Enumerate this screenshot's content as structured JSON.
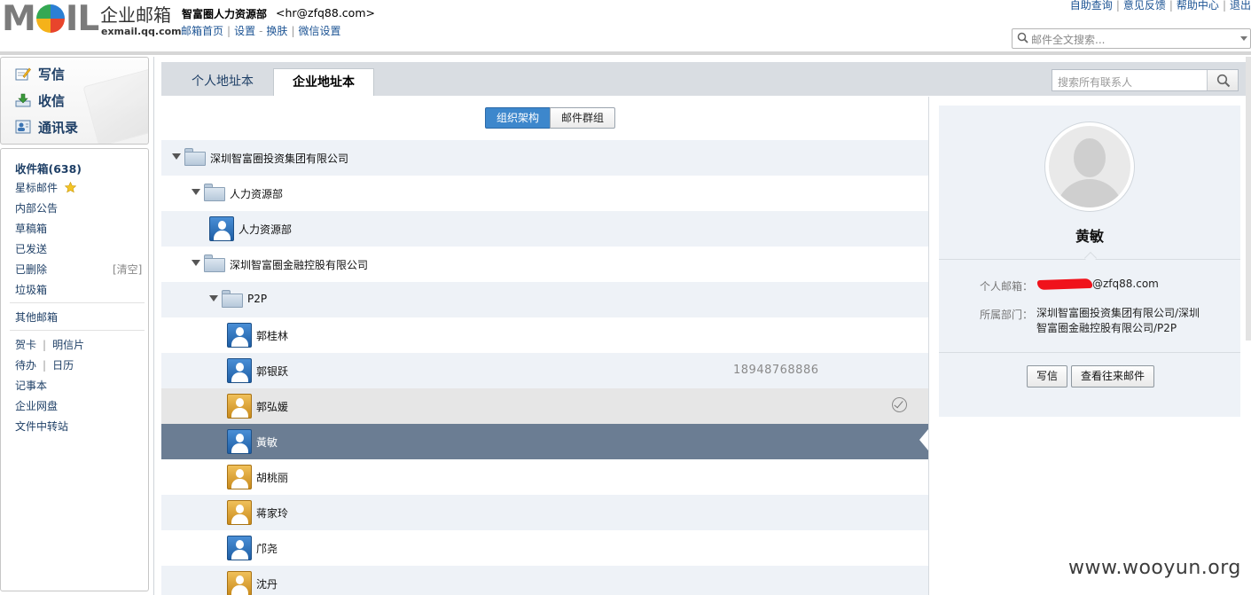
{
  "brand": {
    "logo_text": "MOIL",
    "product_name": "企业邮箱",
    "domain": "exmail.qq.com"
  },
  "account": {
    "name": "智富圈人力资源部",
    "email": "<hr@zfq88.com>"
  },
  "top_links": [
    "邮箱首页",
    "设置",
    "换肤",
    "微信设置"
  ],
  "util_links": [
    "自助查询",
    "意见反馈",
    "帮助中心",
    "退出"
  ],
  "fulltext_search": {
    "placeholder": "邮件全文搜索..."
  },
  "quick_actions": [
    {
      "label": "写信",
      "icon": "compose-icon"
    },
    {
      "label": "收信",
      "icon": "inbox-download-icon"
    },
    {
      "label": "通讯录",
      "icon": "address-book-icon"
    }
  ],
  "folders": {
    "inbox": "收件箱(638)",
    "starred": "星标邮件",
    "announcements": "内部公告",
    "drafts": "草稿箱",
    "sent": "已发送",
    "deleted": "已删除",
    "deleted_clear": "[清空]",
    "spam": "垃圾箱",
    "other": "其他邮箱",
    "greeting_card": "贺卡",
    "postcard": "明信片",
    "todo": "待办",
    "calendar": "日历",
    "notes": "记事本",
    "disk": "企业网盘",
    "transfer": "文件中转站"
  },
  "tabs": [
    {
      "label": "个人地址本",
      "active": false
    },
    {
      "label": "企业地址本",
      "active": true
    }
  ],
  "contact_search": {
    "placeholder": "搜索所有联系人"
  },
  "view_toggle": {
    "org_label": "组织架构",
    "group_label": "邮件群组",
    "selected": "组织架构"
  },
  "tree": [
    {
      "type": "org",
      "label": "深圳智富圈投资集团有限公司",
      "expanded": true
    },
    {
      "type": "org",
      "label": "人力资源部",
      "expanded": true
    },
    {
      "type": "person",
      "label": "人力资源部",
      "avatar": "blue"
    },
    {
      "type": "org",
      "label": "深圳智富圈金融控股有限公司",
      "expanded": true
    },
    {
      "type": "org",
      "label": "P2P",
      "expanded": true
    },
    {
      "type": "person",
      "label": "郭桂林",
      "avatar": "blue"
    },
    {
      "type": "person",
      "label": "郭银跃",
      "avatar": "blue",
      "phone": "18948768886"
    },
    {
      "type": "person",
      "label": "郭弘媛",
      "avatar": "gold",
      "hover": true
    },
    {
      "type": "person",
      "label": "黃敏",
      "avatar": "blue",
      "selected": true
    },
    {
      "type": "person",
      "label": "胡桃丽",
      "avatar": "gold"
    },
    {
      "type": "person",
      "label": "蒋家玲",
      "avatar": "gold"
    },
    {
      "type": "person",
      "label": "邝尧",
      "avatar": "blue"
    },
    {
      "type": "person",
      "label": "沈丹",
      "avatar": "gold"
    }
  ],
  "detail": {
    "name": "黄敏",
    "email_label": "个人邮箱：",
    "email_value": "@zfq88.com",
    "dept_label": "所属部门：",
    "dept_line1": "深圳智富圈投资集团有限公司/深圳",
    "dept_line2": "智富圈金融控股有限公司/P2P",
    "write_button": "写信",
    "history_button": "查看往来邮件"
  },
  "watermark": "www.wooyun.org",
  "colors": {
    "link": "#1d5494",
    "selected_row": "#6b7d93",
    "alt_row": "#eef2f7",
    "toggle_on": "#3d87cc",
    "redaction": "#f0121b"
  }
}
